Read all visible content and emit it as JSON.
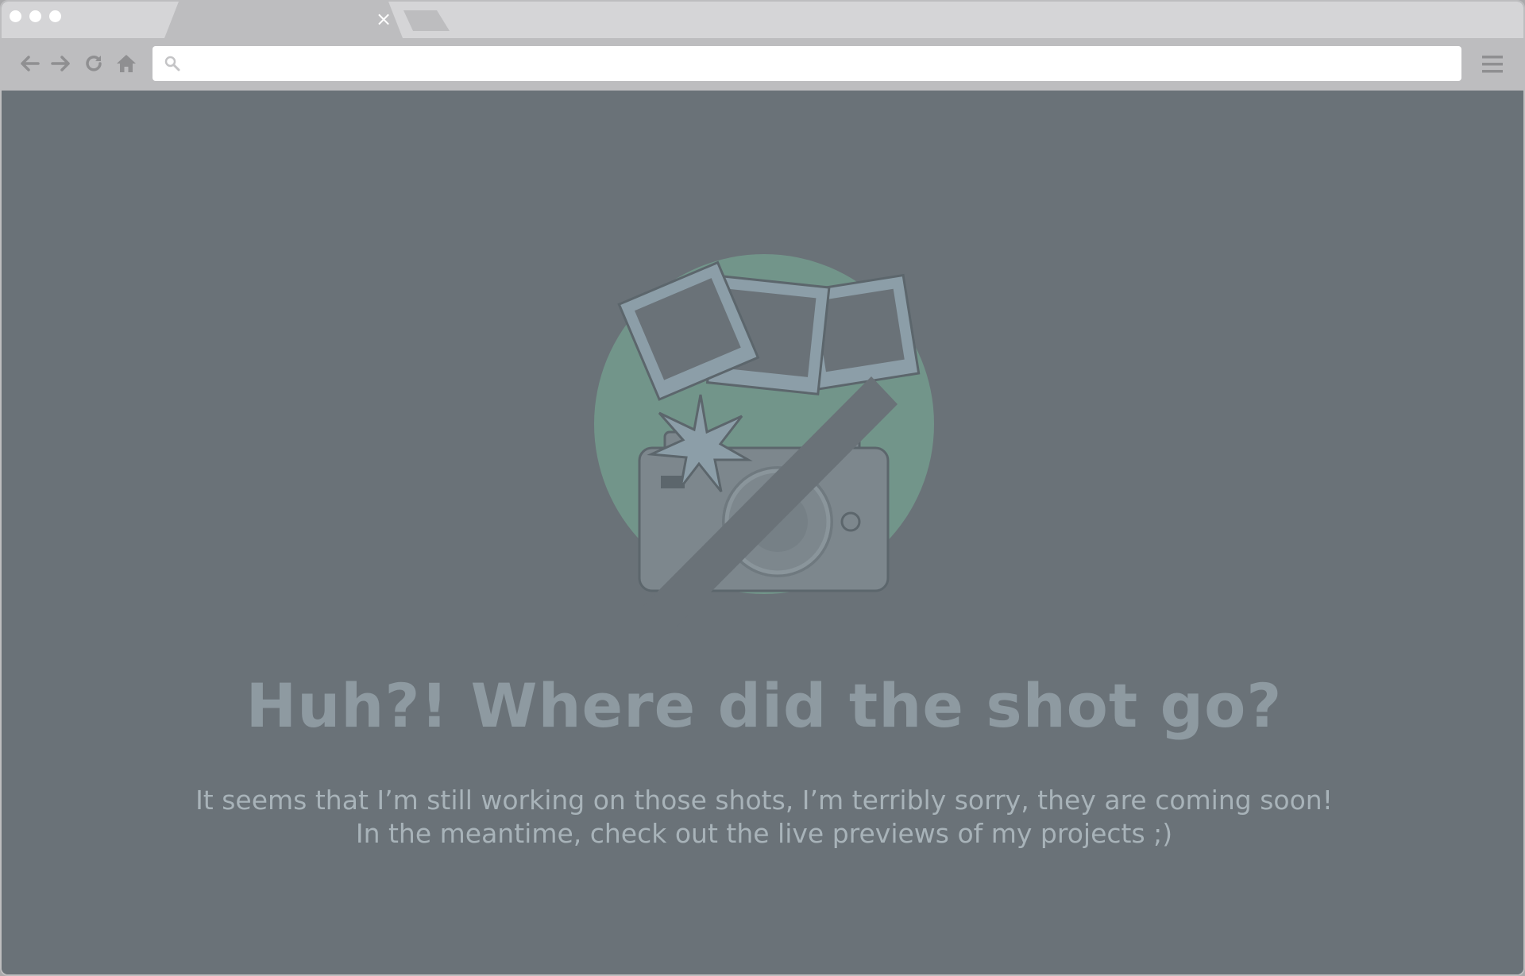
{
  "browser": {
    "tab": {
      "close_glyph": "×"
    },
    "toolbar": {
      "back_icon": "arrow-left-icon",
      "forward_icon": "arrow-right-icon",
      "reload_icon": "reload-icon",
      "home_icon": "home-icon",
      "menu_icon": "hamburger-menu-icon"
    },
    "address_bar": {
      "value": "",
      "placeholder": ""
    }
  },
  "page": {
    "headline": "Huh?! Where did the shot go?",
    "message_line1": "It seems that I’m still working on those shots, I’m terribly sorry, they are coming soon!",
    "message_line2": "In the meantime, check out the live previews of my projects ;)"
  },
  "colors": {
    "page_background": "#6a7278",
    "chrome": "#bdbdbf",
    "tabstrip": "#d5d5d7",
    "circle_accent": "#72958a",
    "headline": "#8e9aa1",
    "message": "#a8b3b9"
  }
}
